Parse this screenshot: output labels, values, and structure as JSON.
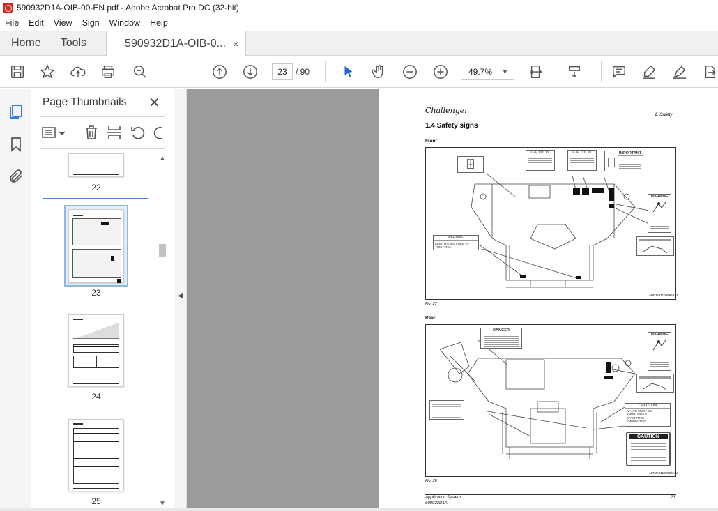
{
  "window": {
    "title": "590932D1A-OIB-00-EN.pdf - Adobe Acrobat Pro DC (32-bit)"
  },
  "menu": [
    "File",
    "Edit",
    "View",
    "Sign",
    "Window",
    "Help"
  ],
  "tabs": {
    "home": "Home",
    "tools": "Tools",
    "document": "590932D1A-OIB-0...",
    "close": "×"
  },
  "toolbar": {
    "current_page": "23",
    "page_count": "/  90",
    "zoom": "49.7%"
  },
  "thumbnails_panel": {
    "title": "Page Thumbnails",
    "pages": [
      "22",
      "23",
      "24",
      "25"
    ]
  },
  "pdf_page": {
    "brand": "Challenger",
    "section_ref": "1. Safety",
    "heading": "1.4   Safety signs",
    "front_label": "Front",
    "rear_label": "Rear",
    "fig27_caption": "Fig. 27",
    "fig28_caption": "Fig. 28",
    "fig27_id": "APFJA21100996A01",
    "fig28_id": "APFJA21100996A03",
    "footer_title": "Application System",
    "footer_code": "590932D1A",
    "footer_page": "23",
    "sign_caution": "CAUTION",
    "sign_important": "IMPORTANT",
    "sign_warning": "WARNING",
    "sign_warning_text": "KEEP HANDS FREE OF THIS AREA",
    "sign_danger": "DANGER",
    "sign_caution_valve": "VALVE MUST BE OPEN WHILE SYSTEM IS OPERATING",
    "sign_caution_big": "CAUTION"
  }
}
